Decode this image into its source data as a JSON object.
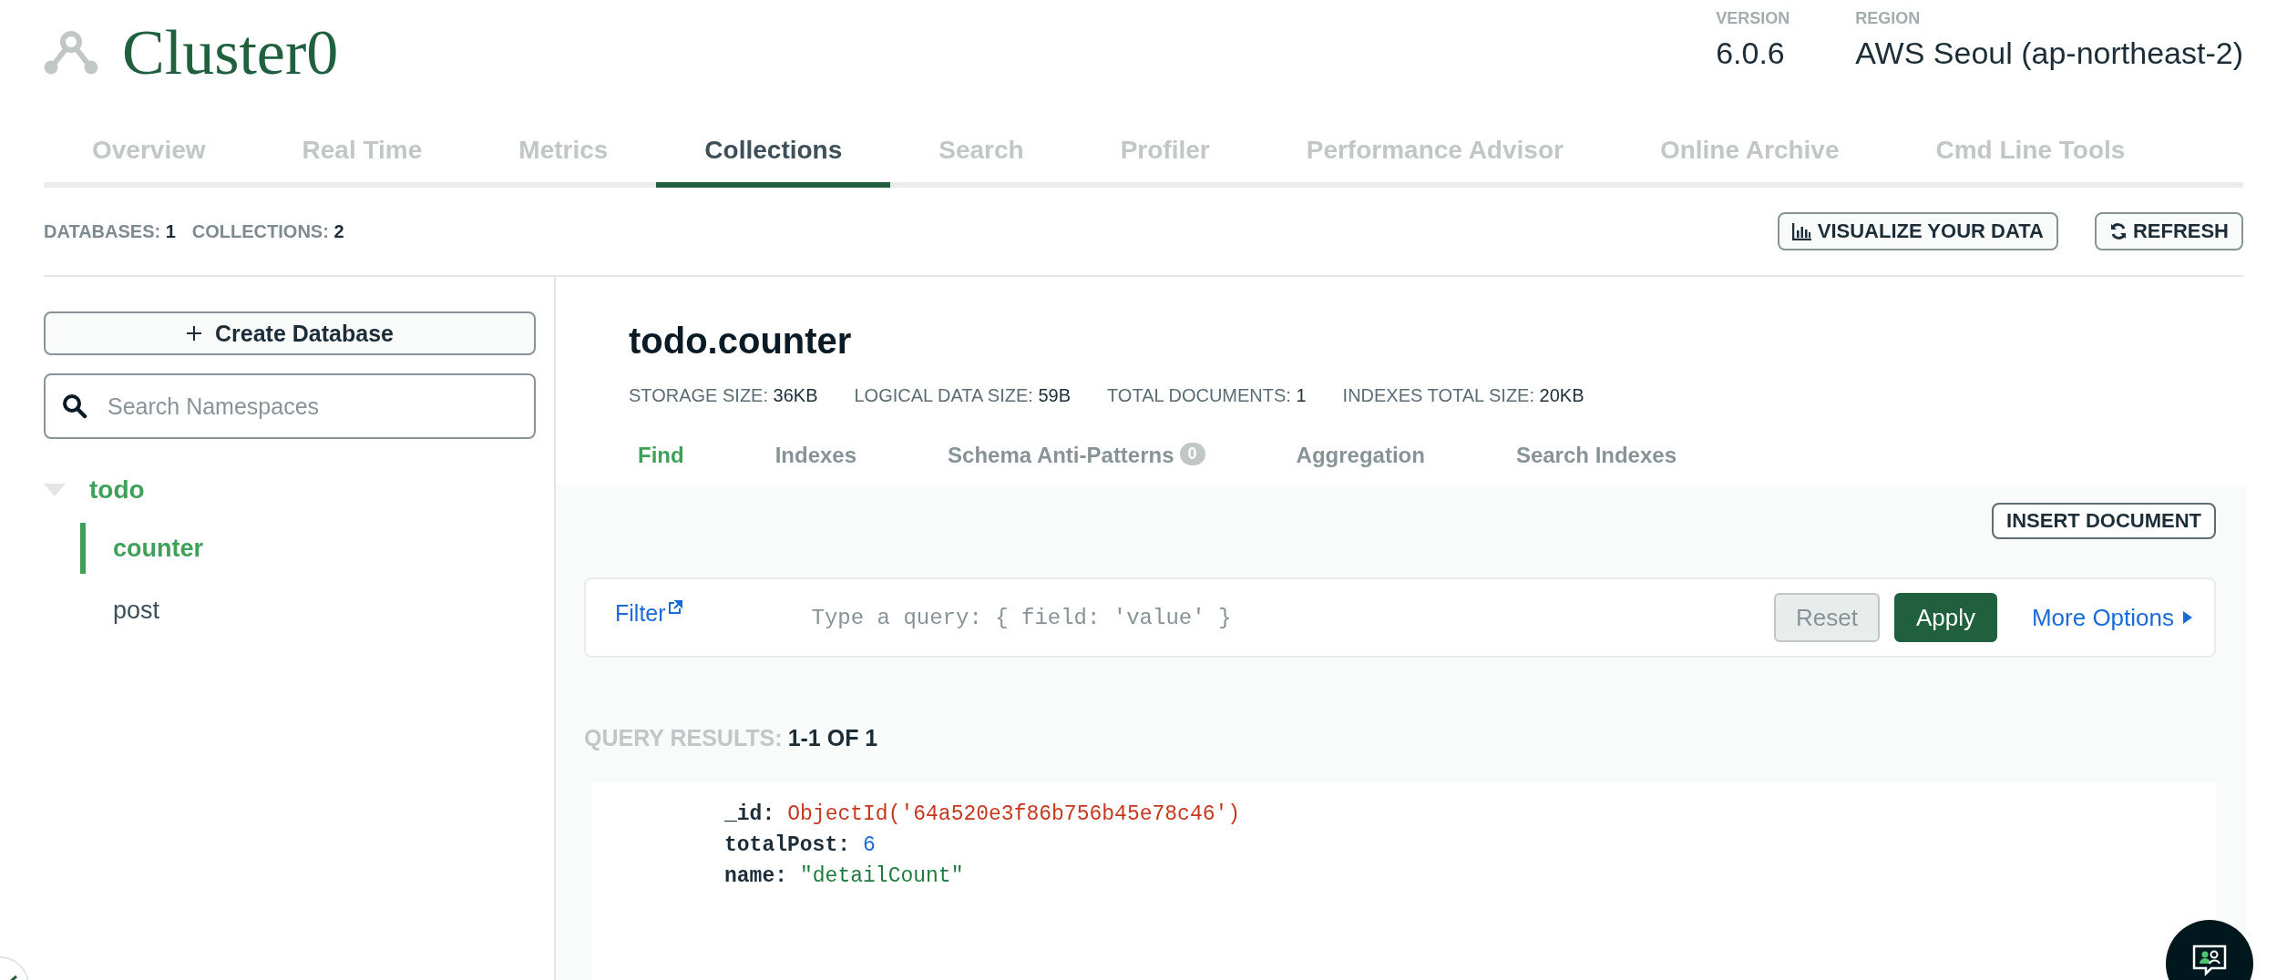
{
  "cluster": {
    "name": "Cluster0"
  },
  "info": [
    {
      "label": "VERSION",
      "value": "6.0.6"
    },
    {
      "label": "REGION",
      "value": "AWS Seoul (ap-northeast-2)"
    }
  ],
  "tabs": [
    {
      "label": "Overview",
      "selected": false
    },
    {
      "label": "Real Time",
      "selected": false
    },
    {
      "label": "Metrics",
      "selected": false
    },
    {
      "label": "Collections",
      "selected": true
    },
    {
      "label": "Search",
      "selected": false
    },
    {
      "label": "Profiler",
      "selected": false
    },
    {
      "label": "Performance Advisor",
      "selected": false
    },
    {
      "label": "Online Archive",
      "selected": false
    },
    {
      "label": "Cmd Line Tools",
      "selected": false
    }
  ],
  "summary": [
    {
      "label": "DATABASES:",
      "value": "1"
    },
    {
      "label": "COLLECTIONS:",
      "value": "2"
    }
  ],
  "toolbar_buttons": [
    {
      "label": "VISUALIZE YOUR DATA",
      "kind": "chart"
    },
    {
      "label": "REFRESH",
      "kind": "refresh"
    }
  ],
  "sidebar": {
    "create_button": "Create Database",
    "search": {
      "placeholder": "Search Namespaces"
    },
    "tree": [
      {
        "label": "todo",
        "expanded": true,
        "selected": true,
        "children": [
          {
            "label": "counter",
            "selected": true
          },
          {
            "label": "post",
            "selected": false
          }
        ]
      }
    ]
  },
  "collection": {
    "title": "todo.counter",
    "stats": [
      {
        "label": "STORAGE SIZE:",
        "value": "36KB"
      },
      {
        "label": "LOGICAL DATA SIZE:",
        "value": "59B"
      },
      {
        "label": "TOTAL DOCUMENTS:",
        "value": "1"
      },
      {
        "label": "INDEXES TOTAL SIZE:",
        "value": "20KB"
      }
    ],
    "tabs": [
      {
        "label": "Find",
        "selected": true
      },
      {
        "label": "Indexes",
        "selected": false
      },
      {
        "label": "Schema Anti-Patterns",
        "selected": false,
        "badge": "0"
      },
      {
        "label": "Aggregation",
        "selected": false
      },
      {
        "label": "Search Indexes",
        "selected": false
      }
    ]
  },
  "insert_button": "INSERT DOCUMENT",
  "filter": {
    "label": "Filter",
    "placeholder": "Type a query: { field: 'value' }",
    "buttons": [
      {
        "label": "Reset",
        "kind": "secondary",
        "disabled": true
      },
      {
        "label": "Apply",
        "kind": "primary",
        "disabled": false
      }
    ],
    "more_options": "More Options"
  },
  "results": {
    "label": "QUERY RESULTS:",
    "value": "1-1 OF 1"
  },
  "documents": [
    {
      "fields": [
        {
          "key": "_id:",
          "value": "ObjectId('64a520e3f86b756b45e78c46')",
          "kind": "objectid"
        },
        {
          "key": "totalPost:",
          "value": "6",
          "kind": "number"
        },
        {
          "key": "name:",
          "value": "\"detailCount\"",
          "kind": "string"
        }
      ]
    }
  ]
}
